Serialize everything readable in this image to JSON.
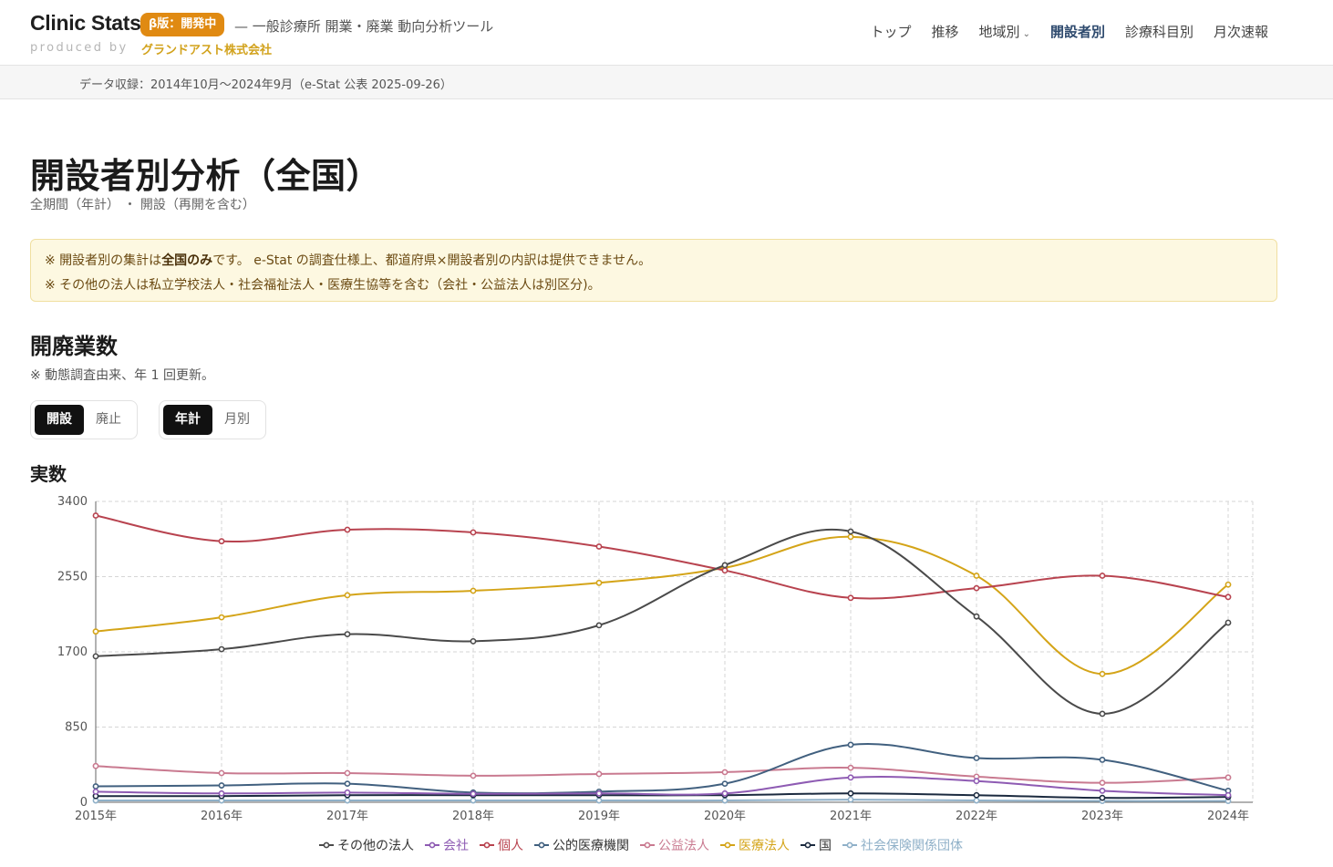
{
  "header": {
    "brand": "Clinic Stats",
    "beta": "β版：開発中",
    "tagline": "— 一般診療所 開業・廃業 動向分析ツール",
    "produced_by": "produced by",
    "company": "グランドアスト株式会社",
    "nav": [
      {
        "label": "トップ",
        "active": false
      },
      {
        "label": "推移",
        "active": false
      },
      {
        "label": "地域別",
        "active": false
      },
      {
        "label": "開設者別",
        "active": true
      },
      {
        "label": "診療科目別",
        "active": false
      },
      {
        "label": "月次速報",
        "active": false
      }
    ]
  },
  "infobar": "データ収録：2014年10月〜2024年9月（e-Stat 公表 2025-09-26）",
  "page": {
    "title": "開設者別分析（全国）",
    "subtitle": "全期間（年計） ・ 開設（再開を含む）",
    "notice_line1_pre": "※ 開設者別の集計は",
    "notice_line1_bold": "全国のみ",
    "notice_line1_post": "です。 e-Stat の調査仕様上、都道府県×開設者別の内訳は提供できません。",
    "notice_line2": "※ その他の法人は私立学校法人・社会福祉法人・医療生協等を含む（会社・公益法人は別区分)。",
    "section_title": "開廃業数",
    "section_note": "※ 動態調査由来、年 1 回更新。",
    "toggle_kind": [
      {
        "label": "開設",
        "on": true
      },
      {
        "label": "廃止",
        "on": false
      }
    ],
    "toggle_period": [
      {
        "label": "年計",
        "on": true
      },
      {
        "label": "月別",
        "on": false
      }
    ],
    "chart_title": "実数"
  },
  "chart_data": {
    "type": "line",
    "x": [
      "2015年",
      "2016年",
      "2017年",
      "2018年",
      "2019年",
      "2020年",
      "2021年",
      "2022年",
      "2023年",
      "2024年"
    ],
    "yticks": [
      0,
      850,
      1700,
      2550,
      3400
    ],
    "ylim": [
      0,
      3400
    ],
    "grid": true,
    "legend": "bottom",
    "series": [
      {
        "name": "その他の法人",
        "color": "#4a4a4a",
        "values": [
          1650,
          1730,
          1900,
          1820,
          2000,
          2680,
          3060,
          2100,
          1000,
          2030
        ]
      },
      {
        "name": "会社",
        "color": "#8e5bb3",
        "values": [
          120,
          100,
          110,
          95,
          100,
          100,
          280,
          240,
          130,
          80
        ]
      },
      {
        "name": "個人",
        "color": "#b8434f",
        "values": [
          3240,
          2950,
          3080,
          3050,
          2890,
          2620,
          2310,
          2420,
          2560,
          2320
        ]
      },
      {
        "name": "公的医療機関",
        "color": "#41607f",
        "values": [
          180,
          190,
          210,
          110,
          120,
          210,
          650,
          500,
          480,
          130
        ]
      },
      {
        "name": "公益法人",
        "color": "#c97a90",
        "values": [
          410,
          330,
          330,
          300,
          320,
          340,
          390,
          290,
          220,
          280
        ]
      },
      {
        "name": "医療法人",
        "color": "#d4a418",
        "values": [
          1930,
          2090,
          2340,
          2390,
          2480,
          2650,
          3000,
          2560,
          1450,
          2460
        ]
      },
      {
        "name": "国",
        "color": "#1b2a3f",
        "values": [
          70,
          70,
          80,
          80,
          80,
          80,
          100,
          80,
          50,
          60
        ]
      },
      {
        "name": "社会保険関係団体",
        "color": "#8fb0c8",
        "values": [
          20,
          20,
          20,
          20,
          20,
          20,
          30,
          20,
          15,
          15
        ]
      }
    ]
  }
}
